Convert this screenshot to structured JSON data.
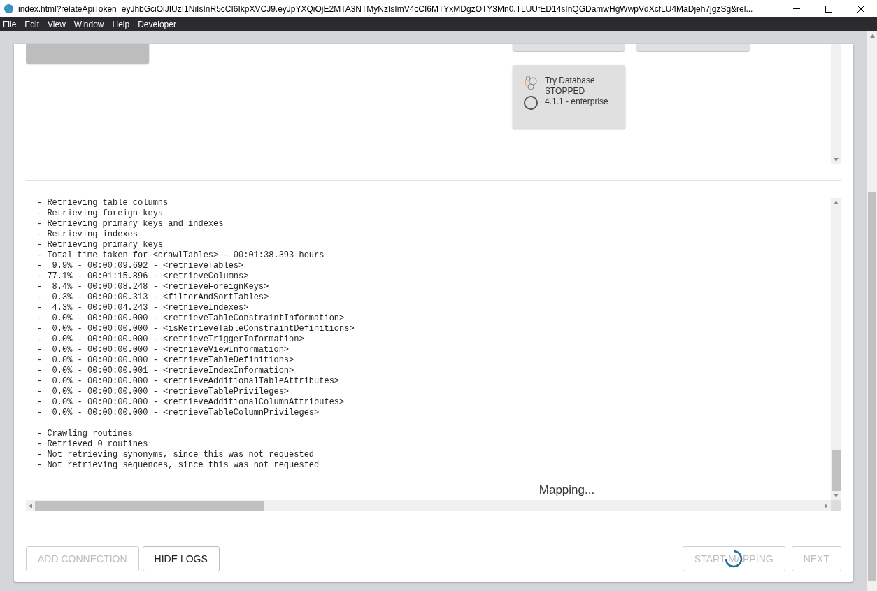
{
  "window": {
    "title": "index.html?relateApiToken=eyJhbGciOiJIUzI1NiIsInR5cCI6IkpXVCJ9.eyJpYXQiOjE2MTA3NTMyNzIsImV4cCI6MTYxMDgzOTY3Mn0.TLUUfED14sInQGDamwHgWwpVdXcfLU4MaDjeh7jgzSg&rel..."
  },
  "menu": [
    "File",
    "Edit",
    "View",
    "Window",
    "Help",
    "Developer"
  ],
  "database_card": {
    "name": "Try Database",
    "status": "STOPPED",
    "version": "4.1.1 - enterprise"
  },
  "log": {
    "blocks": [
      [
        "- Retrieving table columns",
        "- Retrieving foreign keys",
        "- Retrieving primary keys and indexes",
        "- Retrieving indexes",
        "- Retrieving primary keys",
        "- Total time taken for <crawlTables> - 00:01:38.393 hours",
        "-  9.9% - 00:00:09.692 - <retrieveTables>",
        "- 77.1% - 00:01:15.896 - <retrieveColumns>",
        "-  8.4% - 00:00:08.248 - <retrieveForeignKeys>",
        "-  0.3% - 00:00:00.313 - <filterAndSortTables>",
        "-  4.3% - 00:00:04.243 - <retrieveIndexes>",
        "-  0.0% - 00:00:00.000 - <retrieveTableConstraintInformation>",
        "-  0.0% - 00:00:00.000 - <isRetrieveTableConstraintDefinitions>",
        "-  0.0% - 00:00:00.000 - <retrieveTriggerInformation>",
        "-  0.0% - 00:00:00.000 - <retrieveViewInformation>",
        "-  0.0% - 00:00:00.000 - <retrieveTableDefinitions>",
        "-  0.0% - 00:00:00.001 - <retrieveIndexInformation>",
        "-  0.0% - 00:00:00.000 - <retrieveAdditionalTableAttributes>",
        "-  0.0% - 00:00:00.000 - <retrieveTablePrivileges>",
        "-  0.0% - 00:00:00.000 - <retrieveAdditionalColumnAttributes>",
        "-  0.0% - 00:00:00.000 - <retrieveTableColumnPrivileges>"
      ],
      [
        "- Crawling routines",
        "- Retrieved 0 routines",
        "- Not retrieving synonyms, since this was not requested",
        "- Not retrieving sequences, since this was not requested"
      ]
    ],
    "status": "Mapping..."
  },
  "buttons_left": [
    {
      "label": "ADD CONNECTION",
      "disabled": true
    },
    {
      "label": "HIDE LOGS",
      "disabled": false
    }
  ],
  "buttons_right": [
    {
      "label": "START MAPPING",
      "disabled": true,
      "loading": true
    },
    {
      "label": "NEXT",
      "disabled": true,
      "loading": false
    }
  ]
}
